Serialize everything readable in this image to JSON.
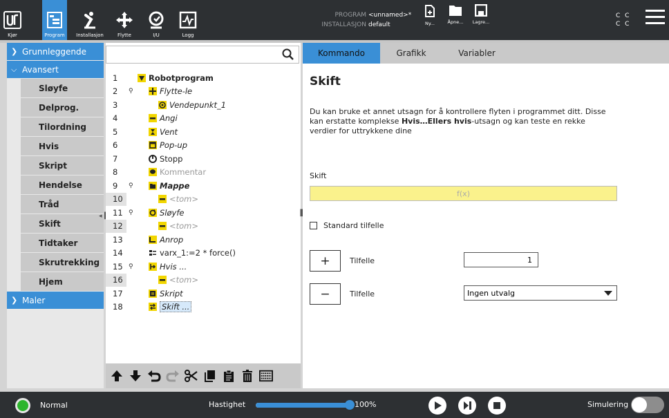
{
  "topbar": {
    "buttons": [
      {
        "label": "Kjør",
        "icon": "ur-logo-icon"
      },
      {
        "label": "Program",
        "icon": "program-tree-icon"
      },
      {
        "label": "Installasjon",
        "icon": "robot-arm-icon"
      },
      {
        "label": "Flytte",
        "icon": "move-arrows-icon"
      },
      {
        "label": "I/U",
        "icon": "io-icon"
      },
      {
        "label": "Logg",
        "icon": "log-icon"
      }
    ],
    "program_key": "PROGRAM",
    "program_val": "<unnamed>*",
    "install_key": "INSTALLASJON",
    "install_val": "default",
    "file_buttons": [
      {
        "label": "Ny...",
        "icon": "new-file-icon"
      },
      {
        "label": "Åpne...",
        "icon": "open-folder-icon"
      },
      {
        "label": "Lagre...",
        "icon": "save-icon"
      }
    ],
    "cc_line1": "C C",
    "cc_line2": "C C"
  },
  "leftnav": {
    "cat_basic": "Grunnleggende",
    "cat_advanced": "Avansert",
    "items": [
      "Sløyfe",
      "Delprog.",
      "Tilordning",
      "Hvis",
      "Skript",
      "Hendelse",
      "Tråd",
      "Skift",
      "Tidtaker",
      "Skrutrekking",
      "Hjem"
    ],
    "cat_templates": "Maler"
  },
  "tree": {
    "search_placeholder": "",
    "lines": [
      {
        "n": "1",
        "text": "Robotprogram",
        "icon": "program-root-icon"
      },
      {
        "n": "2",
        "text": "Flytte-le",
        "icon": "move-icon"
      },
      {
        "n": "3",
        "text": "Vendepunkt_1",
        "icon": "waypoint-icon"
      },
      {
        "n": "4",
        "text": "Angi",
        "icon": "set-icon"
      },
      {
        "n": "5",
        "text": "Vent",
        "icon": "wait-icon"
      },
      {
        "n": "6",
        "text": "Pop-up",
        "icon": "popup-icon"
      },
      {
        "n": "7",
        "text": "Stopp",
        "icon": "stop-icon"
      },
      {
        "n": "8",
        "text": "Kommentar",
        "icon": "comment-icon"
      },
      {
        "n": "9",
        "text": "Mappe",
        "icon": "folder-icon"
      },
      {
        "n": "10",
        "text": "<tom>",
        "icon": "empty-icon"
      },
      {
        "n": "11",
        "text": "Sløyfe",
        "icon": "loop-icon"
      },
      {
        "n": "12",
        "text": "<tom>",
        "icon": "empty-icon"
      },
      {
        "n": "13",
        "text": "Anrop",
        "icon": "call-icon"
      },
      {
        "n": "14",
        "text": "varx_1:=2 * force()",
        "icon": "assignment-icon"
      },
      {
        "n": "15",
        "text": "Hvis ...",
        "icon": "if-icon"
      },
      {
        "n": "16",
        "text": "<tom>",
        "icon": "empty-icon"
      },
      {
        "n": "17",
        "text": "Skript",
        "icon": "script-icon"
      },
      {
        "n": "18",
        "text": "Skift ...",
        "icon": "switch-icon"
      }
    ]
  },
  "tabs": [
    "Kommando",
    "Grafikk",
    "Variabler"
  ],
  "command": {
    "title": "Skift",
    "desc_pre": "Du kan bruke et annet utsagn for å kontrollere flyten i programmet ditt. Disse kan erstatte komplekse ",
    "desc_bold": "Hvis…Ellers hvis",
    "desc_post": "-utsagn og kan teste en rekke verdier for uttrykkene dine",
    "field_label": "Skift",
    "expr_placeholder": "f(x)",
    "default_case": "Standard tilfelle",
    "add_symbol": "+",
    "remove_symbol": "−",
    "case_label_add": "Tilfelle",
    "case_label_remove": "Tilfelle",
    "case_number": "1",
    "case_select": "Ingen utvalg"
  },
  "bottombar": {
    "status": "Normal",
    "speed_label": "Hastighet",
    "speed_value": "100%",
    "speed_fraction": 1.0,
    "sim_label": "Simulering"
  },
  "colors": {
    "accent": "#3a8fd6",
    "topbar": "#2d3033",
    "status_green": "#2db52d",
    "expr_yellow": "#faf28c"
  }
}
